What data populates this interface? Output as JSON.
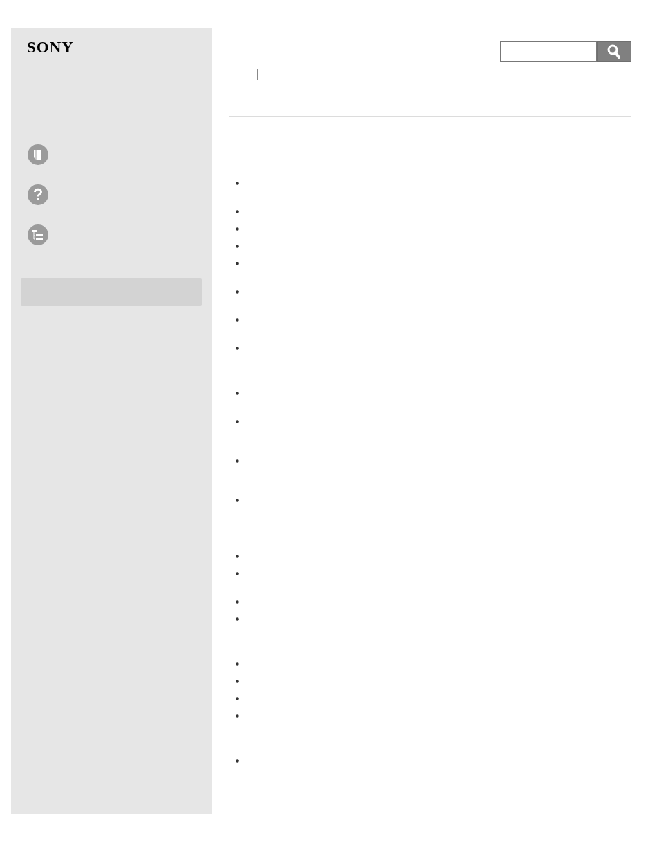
{
  "logo": "SONY",
  "sidebar": {
    "links": [
      {
        "kind": "book"
      },
      {
        "kind": "help"
      },
      {
        "kind": "tree"
      }
    ]
  },
  "content": {
    "sections": [
      {
        "items": [
          {
            "kind": "double"
          },
          {
            "kind": "line"
          },
          {
            "kind": "line"
          },
          {
            "kind": "line"
          },
          {
            "kind": "double"
          },
          {
            "kind": "double"
          },
          {
            "kind": "double"
          },
          {
            "kind": "double"
          }
        ]
      },
      {
        "items": [
          {
            "kind": "double"
          },
          {
            "kind": "triple"
          },
          {
            "kind": "triple"
          },
          {
            "kind": "triple"
          }
        ]
      },
      {
        "items": [
          {
            "kind": "line"
          },
          {
            "kind": "double"
          },
          {
            "kind": "line"
          },
          {
            "kind": "double"
          }
        ]
      },
      {
        "items": [
          {
            "kind": "line"
          },
          {
            "kind": "line"
          },
          {
            "kind": "line"
          },
          {
            "kind": "double"
          }
        ]
      },
      {
        "items": [
          {
            "kind": "line"
          }
        ]
      }
    ]
  }
}
